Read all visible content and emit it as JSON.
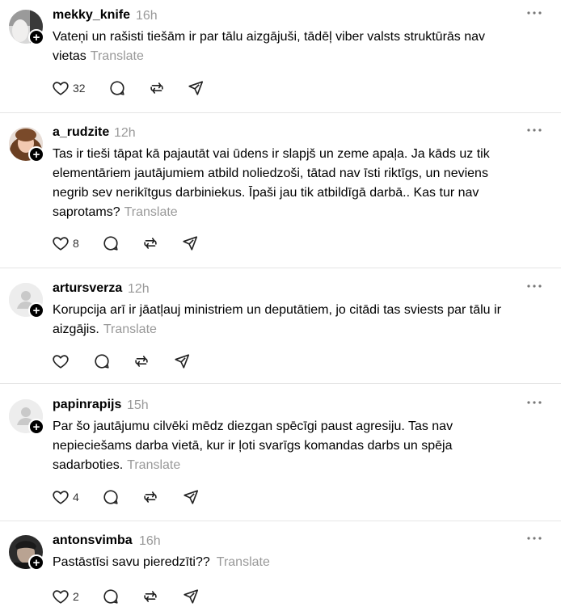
{
  "colors": {
    "text": "#000000",
    "muted": "#999999",
    "divider": "#e5e5e5",
    "badge": "#000000"
  },
  "posts": [
    {
      "username": "mekky_knife",
      "time": "16h",
      "text": "Vateņi un rašisti tiešām ir par tālu aizgājuši, tādēļ viber valsts struktūrās nav vietas",
      "translate": "Translate",
      "likes": "32",
      "avatar": "photo-avatar"
    },
    {
      "username": "a_rudzite",
      "time": "12h",
      "text": "Tas ir tieši tāpat kā pajautāt vai ūdens ir slapjš un zeme apaļa. Ja kāds uz tik elementāriem jautājumiem atbild noliedzoši, tātad nav īsti riktīgs, un neviens negrib sev nerikītgus darbiniekus. Īpaši jau tik atbildīgā darbā.. Kas tur nav saprotams?",
      "translate": "Translate",
      "likes": "8",
      "avatar": "photo-avatar"
    },
    {
      "username": "artursverza",
      "time": "12h",
      "text": "Korupcija arī ir jāatļauj ministriem un deputātiem, jo citādi tas sviests par tālu ir aizgājis.",
      "translate": "Translate",
      "likes": "",
      "avatar": "default-avatar"
    },
    {
      "username": "papinrapijs",
      "time": "15h",
      "text": "Par šo jautājumu cilvēki mēdz diezgan spēcīgi paust agresiju. Tas nav nepieciešams darba vietā, kur ir ļoti svarīgs komandas darbs un spēja sadarboties.",
      "translate": "Translate",
      "likes": "4",
      "avatar": "default-avatar"
    },
    {
      "username": "antonsvimba",
      "time": "16h",
      "text": "Pastāstīsi savu pieredzīti??",
      "translate": "Translate",
      "likes": "2",
      "avatar": "photo-avatar"
    }
  ],
  "icons": {
    "more": "more-icon",
    "like": "heart-icon",
    "reply": "comment-icon",
    "repost": "repost-icon",
    "share": "share-icon",
    "follow": "plus-icon"
  }
}
